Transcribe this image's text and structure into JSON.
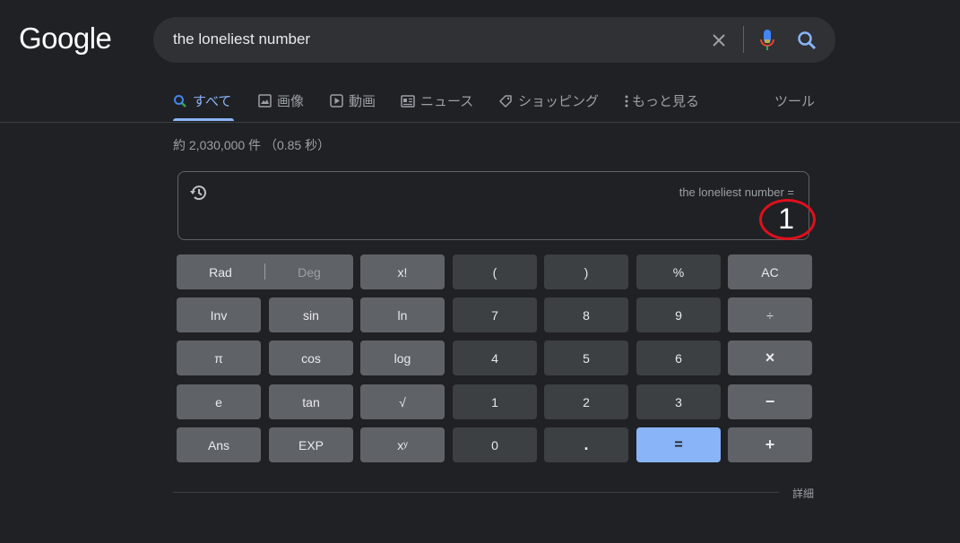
{
  "logo": "Google",
  "search": {
    "query": "the loneliest number"
  },
  "tabs": [
    {
      "label": "すべて",
      "icon": "search-icon",
      "active": true
    },
    {
      "label": "画像",
      "icon": "image-icon"
    },
    {
      "label": "動画",
      "icon": "video-icon"
    },
    {
      "label": "ニュース",
      "icon": "news-icon"
    },
    {
      "label": "ショッピング",
      "icon": "tag-icon"
    },
    {
      "label": "もっと見る",
      "icon": "more-vert-icon"
    }
  ],
  "tools_label": "ツール",
  "result_stats": "約 2,030,000 件 （0.85 秒）",
  "calculator": {
    "expression": "the loneliest number =",
    "result": "1",
    "rad_label": "Rad",
    "deg_label": "Deg",
    "keys": [
      [
        "x!",
        "(",
        ")",
        "%",
        "AC"
      ],
      [
        "Inv",
        "sin",
        "ln",
        "7",
        "8",
        "9",
        "÷"
      ],
      [
        "π",
        "cos",
        "log",
        "4",
        "5",
        "6",
        "×"
      ],
      [
        "e",
        "tan",
        "√",
        "1",
        "2",
        "3",
        "−"
      ],
      [
        "Ans",
        "EXP",
        "xʸ",
        "0",
        ".",
        "=",
        "+"
      ]
    ]
  },
  "details_label": "詳細",
  "colors": {
    "accent": "#8ab4f8",
    "highlight_circle": "#e0101c",
    "background": "#202124"
  }
}
